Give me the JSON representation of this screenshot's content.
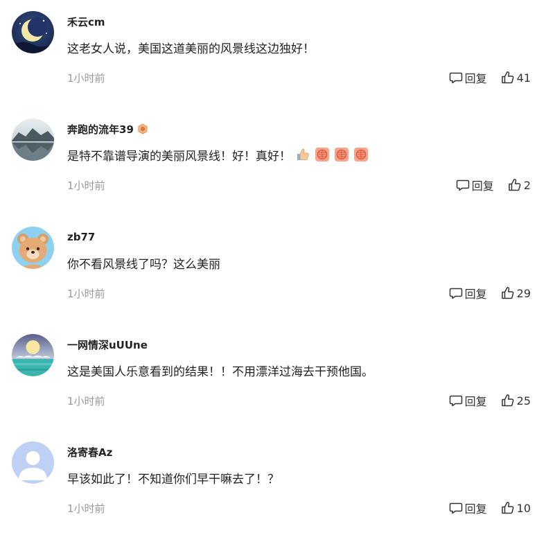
{
  "colors": {
    "text": "#222222",
    "muted": "#999999",
    "background": "#ffffff"
  },
  "comments": [
    {
      "username": "禾云cm",
      "avatar_icon": "crescent-moon-night-avatar",
      "has_badge": false,
      "content": "这老女人说，美国这道美丽的风景线这边独好！",
      "emojis": [],
      "timestamp": "1小时前",
      "reply_label": "回复",
      "like_count": "41"
    },
    {
      "username": "奔跑的流年39",
      "avatar_icon": "mountain-lake-avatar",
      "has_badge": true,
      "badge_icon": "hexagon-level-badge-icon",
      "content": "是特不靠谱导演的美丽风景线！好！真好！",
      "emojis": [
        "thumbs-up-emoji",
        "fan-emoji",
        "fan-emoji",
        "fan-emoji"
      ],
      "timestamp": "1小时前",
      "reply_label": "回复",
      "like_count": "2"
    },
    {
      "username": "zb77",
      "avatar_icon": "teddy-bear-avatar",
      "has_badge": false,
      "content": "你不看风景线了吗？这么美丽",
      "emojis": [],
      "timestamp": "1小时前",
      "reply_label": "回复",
      "like_count": "29"
    },
    {
      "username": "一网情深uUUne",
      "avatar_icon": "sun-over-sea-avatar",
      "has_badge": false,
      "content": "这是美国人乐意看到的结果！！不用漂洋过海去干预他国。",
      "emojis": [],
      "timestamp": "1小时前",
      "reply_label": "回复",
      "like_count": "25"
    },
    {
      "username": "洛寄春Az",
      "avatar_icon": "default-user-avatar",
      "has_badge": false,
      "content": "早该如此了！不知道你们早干嘛去了！？",
      "emojis": [],
      "timestamp": "1小时前",
      "reply_label": "回复",
      "like_count": "10"
    }
  ]
}
